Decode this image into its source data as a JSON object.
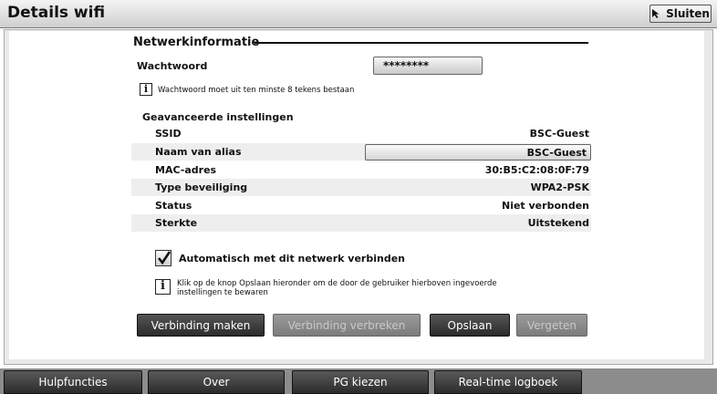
{
  "window": {
    "title": "Details wifi",
    "close_label": "Sluiten"
  },
  "network_info": {
    "heading": "Netwerkinformatie",
    "password_label": "Wachtwoord",
    "password_value": "********",
    "password_note": "Wachtwoord moet uit ten minste 8 tekens bestaan"
  },
  "advanced": {
    "heading": "Geavanceerde instellingen",
    "rows": [
      {
        "key": "SSID",
        "value": "BSC-Guest"
      },
      {
        "key": "Naam van alias",
        "value": "BSC-Guest"
      },
      {
        "key": "MAC-adres",
        "value": "30:B5:C2:08:0F:79"
      },
      {
        "key": "Type beveiliging",
        "value": "WPA2-PSK"
      },
      {
        "key": "Status",
        "value": "Niet verbonden"
      },
      {
        "key": "Sterkte",
        "value": "Uitstekend"
      }
    ]
  },
  "auto_connect": {
    "label": "Automatisch met dit netwerk verbinden",
    "checked": true
  },
  "save_note": {
    "line1": "Klik op de knop Opslaan hieronder om de door de gebruiker hierboven ingevoerde",
    "line2": "instellingen te bewaren"
  },
  "actions": {
    "connect": "Verbinding maken",
    "disconnect": "Verbinding verbreken",
    "save": "Opslaan",
    "forget": "Vergeten"
  },
  "tabs": [
    "Hulpfuncties",
    "Over",
    "PG kiezen",
    "Real-time logboek"
  ]
}
